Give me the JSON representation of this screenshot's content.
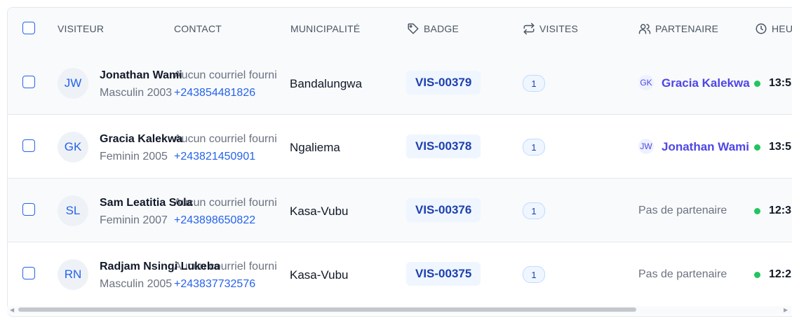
{
  "headers": {
    "visitor": "VISITEUR",
    "contact": "CONTACT",
    "municipality": "MUNICIPALITÉ",
    "badge": "BADGE",
    "visits": "VISITES",
    "partner": "PARTENAIRE",
    "hour": "HEU"
  },
  "icons": {
    "badge": "tag-icon",
    "visits": "repeat-arrows-icon",
    "partner": "users-icon",
    "hour": "clock-icon"
  },
  "rows": [
    {
      "initials": "JW",
      "name": "Jonathan Wami",
      "details": "Masculin 2003",
      "email": "Aucun courriel fourni",
      "phone": "+243854481826",
      "municipality": "Bandalungwa",
      "badge": "VIS-00379",
      "visits": "1",
      "partner_initials": "GK",
      "partner": "Gracia Kalekwa",
      "time": "13:5"
    },
    {
      "initials": "GK",
      "name": "Gracia Kalekwa",
      "details": "Feminin 2005",
      "email": "Aucun courriel fourni",
      "phone": "+243821450901",
      "municipality": "Ngaliema",
      "badge": "VIS-00378",
      "visits": "1",
      "partner_initials": "JW",
      "partner": "Jonathan Wami",
      "time": "13:5"
    },
    {
      "initials": "SL",
      "name": "Sam Leatitia Sola",
      "details": "Feminin 2007",
      "email": "Aucun courriel fourni",
      "phone": "+243898650822",
      "municipality": "Kasa-Vubu",
      "badge": "VIS-00376",
      "visits": "1",
      "no_partner": "Pas de partenaire",
      "time": "12:3"
    },
    {
      "initials": "RN",
      "name": "Radjam Nsingi Lukeba",
      "details": "Masculin 2005",
      "email": "Aucun courriel fourni",
      "phone": "+243837732576",
      "municipality": "Kasa-Vubu",
      "badge": "VIS-00375",
      "visits": "1",
      "no_partner": "Pas de partenaire",
      "time": "12:2"
    }
  ],
  "colors": {
    "accent": "#2563eb",
    "partner": "#4f46e5",
    "status_dot": "#22c55e"
  }
}
